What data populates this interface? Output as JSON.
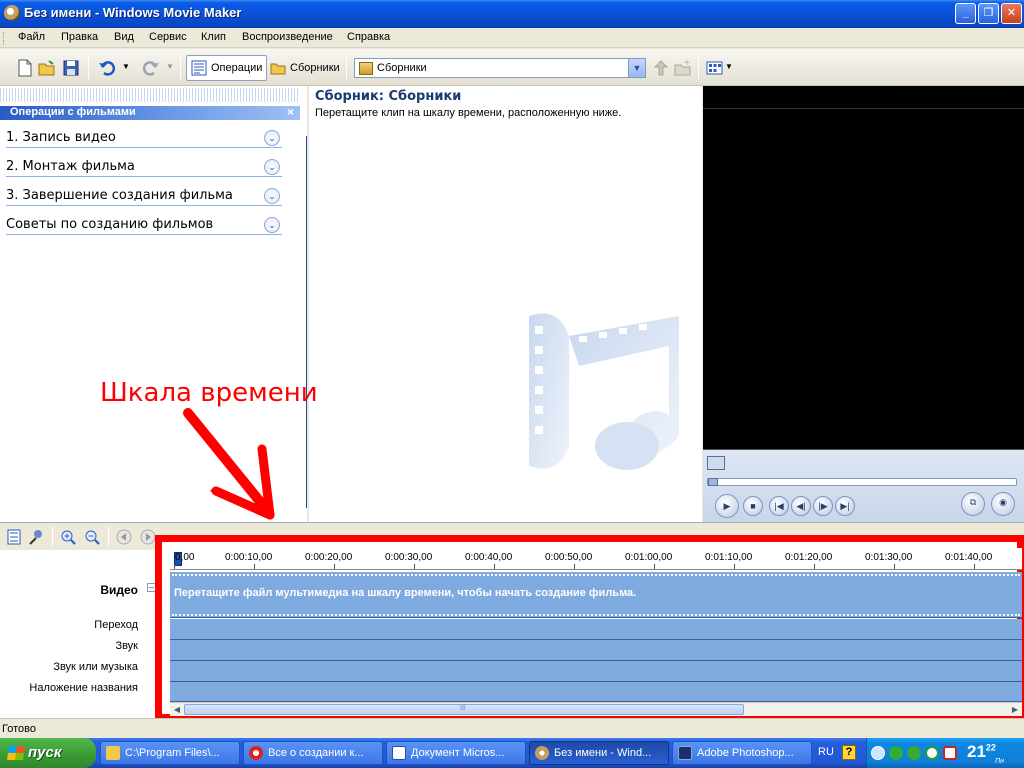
{
  "window": {
    "title": "Без имени - Windows Movie Maker",
    "minimize": "_",
    "maximize": "❐",
    "close": "✕"
  },
  "menu": [
    "Файл",
    "Правка",
    "Вид",
    "Сервис",
    "Клип",
    "Воспроизведение",
    "Справка"
  ],
  "toolbar": {
    "operations_label": "Операции",
    "collections_label": "Сборники",
    "collection_combo_value": "Сборники"
  },
  "tasks": {
    "header": "Операции с фильмами",
    "close_glyph": "×",
    "items": [
      {
        "label": "1. Запись видео"
      },
      {
        "label": "2. Монтаж фильма"
      },
      {
        "label": "3. Завершение создания фильма"
      },
      {
        "label": "Советы по созданию фильмов"
      }
    ]
  },
  "collection": {
    "title": "Сборник: Сборники",
    "subtitle": "Перетащите клип на шкалу времени, расположенную ниже."
  },
  "annotation": {
    "text": "Шкала времени",
    "color": "#ff0000"
  },
  "timeline": {
    "ticks": [
      "0,00",
      "0:00:10,00",
      "0:00:20,00",
      "0:00:30,00",
      "0:00:40,00",
      "0:00:50,00",
      "0:01:00,00",
      "0:01:10,00",
      "0:01:20,00",
      "0:01:30,00",
      "0:01:40,00"
    ],
    "track_labels": {
      "video": "Видео",
      "transition": "Переход",
      "audio": "Звук",
      "audio_music": "Звук или музыка",
      "title_overlay": "Наложение названия"
    },
    "video_hint": "Перетащите файл мультимедиа на шкалу времени, чтобы начать создание фильма.",
    "scroll_center": "III"
  },
  "status": {
    "text": "Готово"
  },
  "taskbar": {
    "start_label": "пуск",
    "items": [
      {
        "label": "C:\\Program Files\\..."
      },
      {
        "label": "Все о создании к..."
      },
      {
        "label": "Документ Micros..."
      },
      {
        "label": "Без имени - Wind..."
      },
      {
        "label": "Adobe Photoshop..."
      }
    ],
    "lang": "RU",
    "help": "?",
    "clock_hour": "21",
    "clock_minutes": "22",
    "clock_day": "Пн"
  },
  "colors": {
    "title_bar": "#0a52d8",
    "timeline_border": "#ff0000",
    "track_fill": "#7eaadf",
    "taskbar": "#245edb"
  }
}
